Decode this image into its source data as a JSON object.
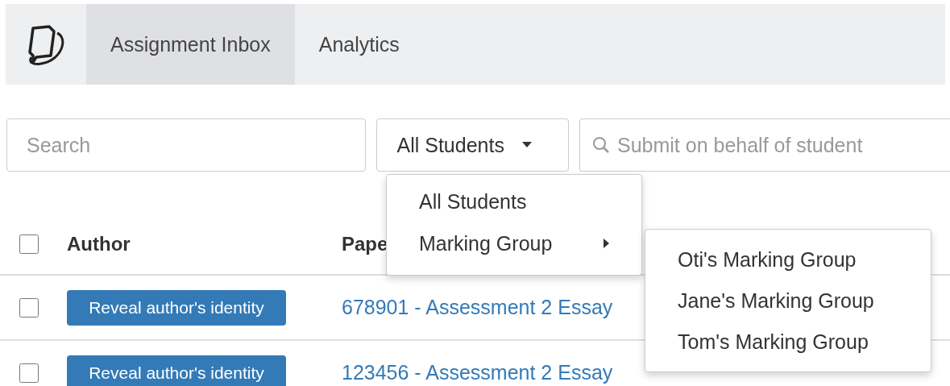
{
  "nav": {
    "tabs": [
      {
        "label": "Assignment Inbox",
        "selected": true
      },
      {
        "label": "Analytics",
        "selected": false
      }
    ]
  },
  "toolbar": {
    "search": {
      "placeholder": "Search"
    },
    "filter": {
      "value": "All Students",
      "expanded": true,
      "menu": [
        {
          "label": "All Students",
          "kind": "item"
        },
        {
          "label": "Marking Group",
          "kind": "submenu",
          "expanded": true,
          "children": [
            {
              "label": "Oti's Marking Group"
            },
            {
              "label": "Jane's Marking Group"
            },
            {
              "label": "Tom's Marking Group"
            }
          ]
        }
      ]
    },
    "submit": {
      "placeholder": "Submit on behalf of student"
    }
  },
  "table": {
    "select_all": {
      "checked": false
    },
    "columns": [
      "Author",
      "Pape"
    ],
    "rows": [
      {
        "checked": false,
        "author_button": "Reveal author's identity",
        "paper": "678901 - Assessment 2 Essay"
      },
      {
        "checked": false,
        "author_button": "Reveal author's identity",
        "paper": "123456 - Assessment 2 Essay"
      }
    ]
  }
}
